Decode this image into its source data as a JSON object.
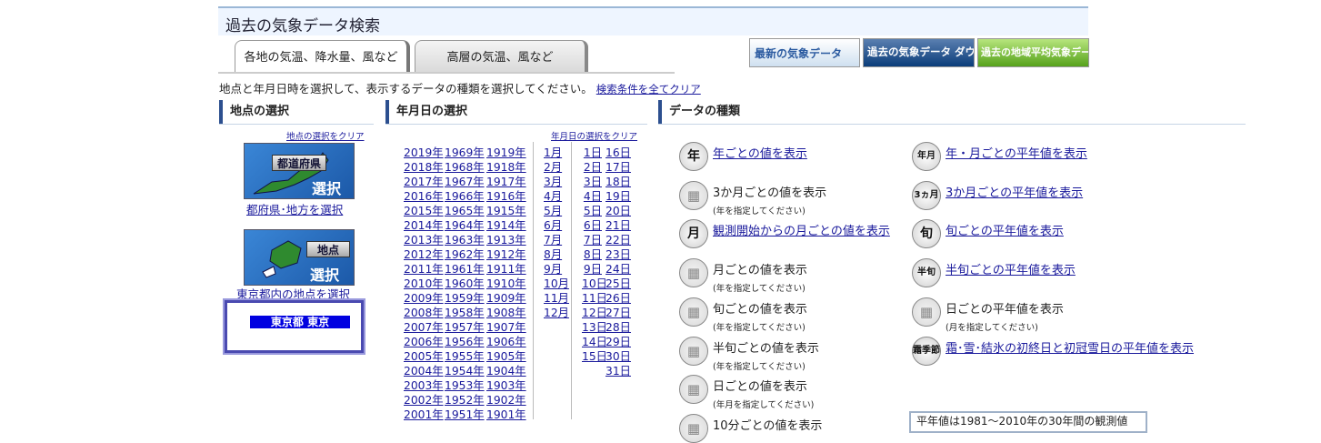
{
  "page_title": "過去の気象データ検索",
  "tabs": [
    {
      "label": "各地の気温、降水量、風など"
    },
    {
      "label": "高層の気温、風など"
    }
  ],
  "banners": {
    "latest": "最新の気象データ",
    "download": "過去の気象データ ダウンロード",
    "regional_avg": "過去の地域平均気象データ 検索"
  },
  "instruction": "地点と年月日時を選択して、表示するデータの種類を選択してください。",
  "clear_all": "検索条件を全てクリア",
  "sections": {
    "station": "地点の選択",
    "date": "年月日の選択",
    "data": "データの種類"
  },
  "station": {
    "clear": "地点の選択をクリア",
    "pref_btn_label": "都道府県",
    "pref_btn_big": "選択",
    "pref_link": "都府県･地方を選択",
    "point_btn_label": "地点",
    "point_btn_big": "選択",
    "point_link": "東京都内の地点を選択",
    "selected": "東京都 東京"
  },
  "date": {
    "clear": "年月日の選択をクリア",
    "years_col1": [
      "2019年",
      "2018年",
      "2017年",
      "2016年",
      "2015年",
      "2014年",
      "2013年",
      "2012年",
      "2011年",
      "2010年",
      "2009年",
      "2008年",
      "2007年",
      "2006年",
      "2005年",
      "2004年",
      "2003年",
      "2002年",
      "2001年"
    ],
    "years_col2": [
      "1969年",
      "1968年",
      "1967年",
      "1966年",
      "1965年",
      "1964年",
      "1963年",
      "1962年",
      "1961年",
      "1960年",
      "1959年",
      "1958年",
      "1957年",
      "1956年",
      "1955年",
      "1954年",
      "1953年",
      "1952年",
      "1951年"
    ],
    "years_col3": [
      "1919年",
      "1918年",
      "1917年",
      "1916年",
      "1915年",
      "1914年",
      "1913年",
      "1912年",
      "1911年",
      "1910年",
      "1909年",
      "1908年",
      "1907年",
      "1906年",
      "1905年",
      "1904年",
      "1903年",
      "1902年",
      "1901年"
    ],
    "months": [
      "1月",
      "2月",
      "3月",
      "4月",
      "5月",
      "6月",
      "7月",
      "8月",
      "9月",
      "10月",
      "11月",
      "12月"
    ],
    "days_col1": [
      "1日",
      "2日",
      "3日",
      "4日",
      "5日",
      "6日",
      "7日",
      "8日",
      "9日",
      "10日",
      "11日",
      "12日",
      "13日",
      "14日",
      "15日"
    ],
    "days_col2": [
      "16日",
      "17日",
      "18日",
      "19日",
      "20日",
      "21日",
      "22日",
      "23日",
      "24日",
      "25日",
      "26日",
      "27日",
      "28日",
      "29日",
      "30日",
      "31日"
    ]
  },
  "data_types_left": [
    {
      "icon": "年",
      "label": "年ごとの値を表示",
      "note": "",
      "link": true
    },
    {
      "icon": "",
      "label": "3か月ごとの値を表示",
      "note": "(年を指定してください)",
      "link": false
    },
    {
      "icon": "月",
      "label": "観測開始からの月ごとの値を表示",
      "note": "",
      "link": true
    },
    {
      "icon": "",
      "label": "月ごとの値を表示",
      "note": "(年を指定してください)",
      "link": false
    },
    {
      "icon": "",
      "label": "旬ごとの値を表示",
      "note": "(年を指定してください)",
      "link": false
    },
    {
      "icon": "",
      "label": "半旬ごとの値を表示",
      "note": "(年を指定してください)",
      "link": false
    },
    {
      "icon": "",
      "label": "日ごとの値を表示",
      "note": "(年月を指定してください)",
      "link": false
    },
    {
      "icon": "",
      "label": "10分ごとの値を表示",
      "note": "",
      "link": false
    }
  ],
  "data_types_right": [
    {
      "icon": "年月",
      "label": "年・月ごとの平年値を表示",
      "note": "",
      "link": true
    },
    {
      "icon": "3ヵ月",
      "label": "3か月ごとの平年値を表示",
      "note": "",
      "link": true
    },
    {
      "icon": "旬",
      "label": "旬ごとの平年値を表示",
      "note": "",
      "link": true
    },
    {
      "icon": "半旬",
      "label": "半旬ごとの平年値を表示",
      "note": "",
      "link": true
    },
    {
      "icon": "",
      "label": "日ごとの平年値を表示",
      "note": "(月を指定してください)",
      "link": false
    },
    {
      "icon": "霜季節",
      "label": "霜･雪･結氷の初終日と初冠雪日の平年値を表示",
      "note": "",
      "link": true
    }
  ],
  "bottom_note": "平年値は1981～2010年の30年間の観測値"
}
